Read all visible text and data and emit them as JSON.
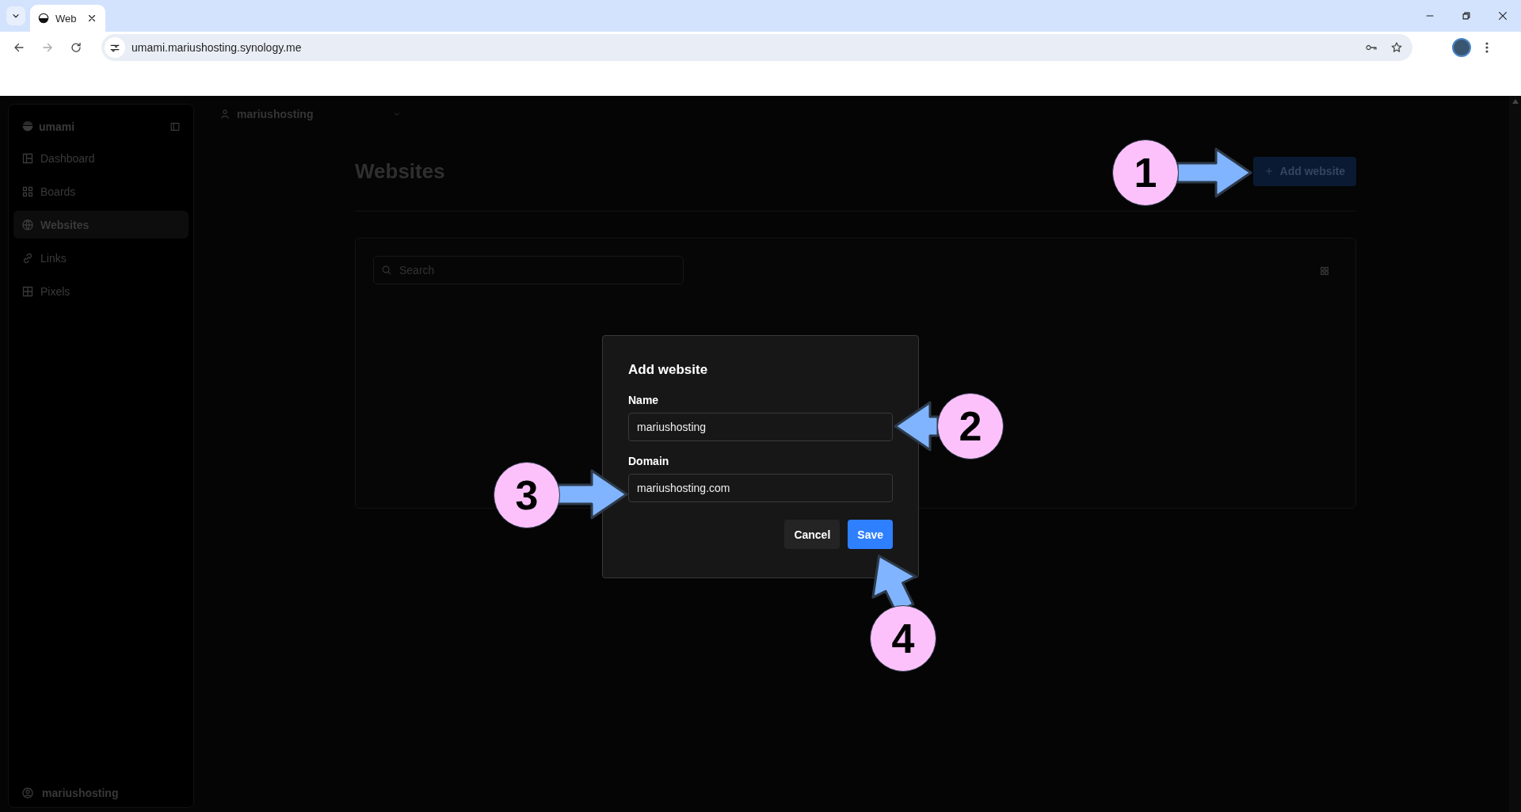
{
  "browser": {
    "tab_title": "Web",
    "url": "umami.mariushosting.synology.me"
  },
  "sidebar": {
    "brand": "umami",
    "items": [
      {
        "label": "Dashboard",
        "selected": false
      },
      {
        "label": "Boards",
        "selected": false
      },
      {
        "label": "Websites",
        "selected": true
      },
      {
        "label": "Links",
        "selected": false
      },
      {
        "label": "Pixels",
        "selected": false
      }
    ],
    "user": "mariushosting"
  },
  "team_selector": "mariushosting",
  "page": {
    "title": "Websites",
    "add_button": "Add website",
    "search": {
      "placeholder": "Search"
    }
  },
  "dialog": {
    "title": "Add website",
    "fields": [
      {
        "label": "Name",
        "value": "mariushosting"
      },
      {
        "label": "Domain",
        "value": "mariushosting.com"
      }
    ],
    "buttons": [
      {
        "label": "Cancel",
        "kind": "secondary"
      },
      {
        "label": "Save",
        "kind": "primary"
      }
    ]
  },
  "callouts": [
    {
      "number": "1"
    },
    {
      "number": "2"
    },
    {
      "number": "3"
    },
    {
      "number": "4"
    }
  ]
}
